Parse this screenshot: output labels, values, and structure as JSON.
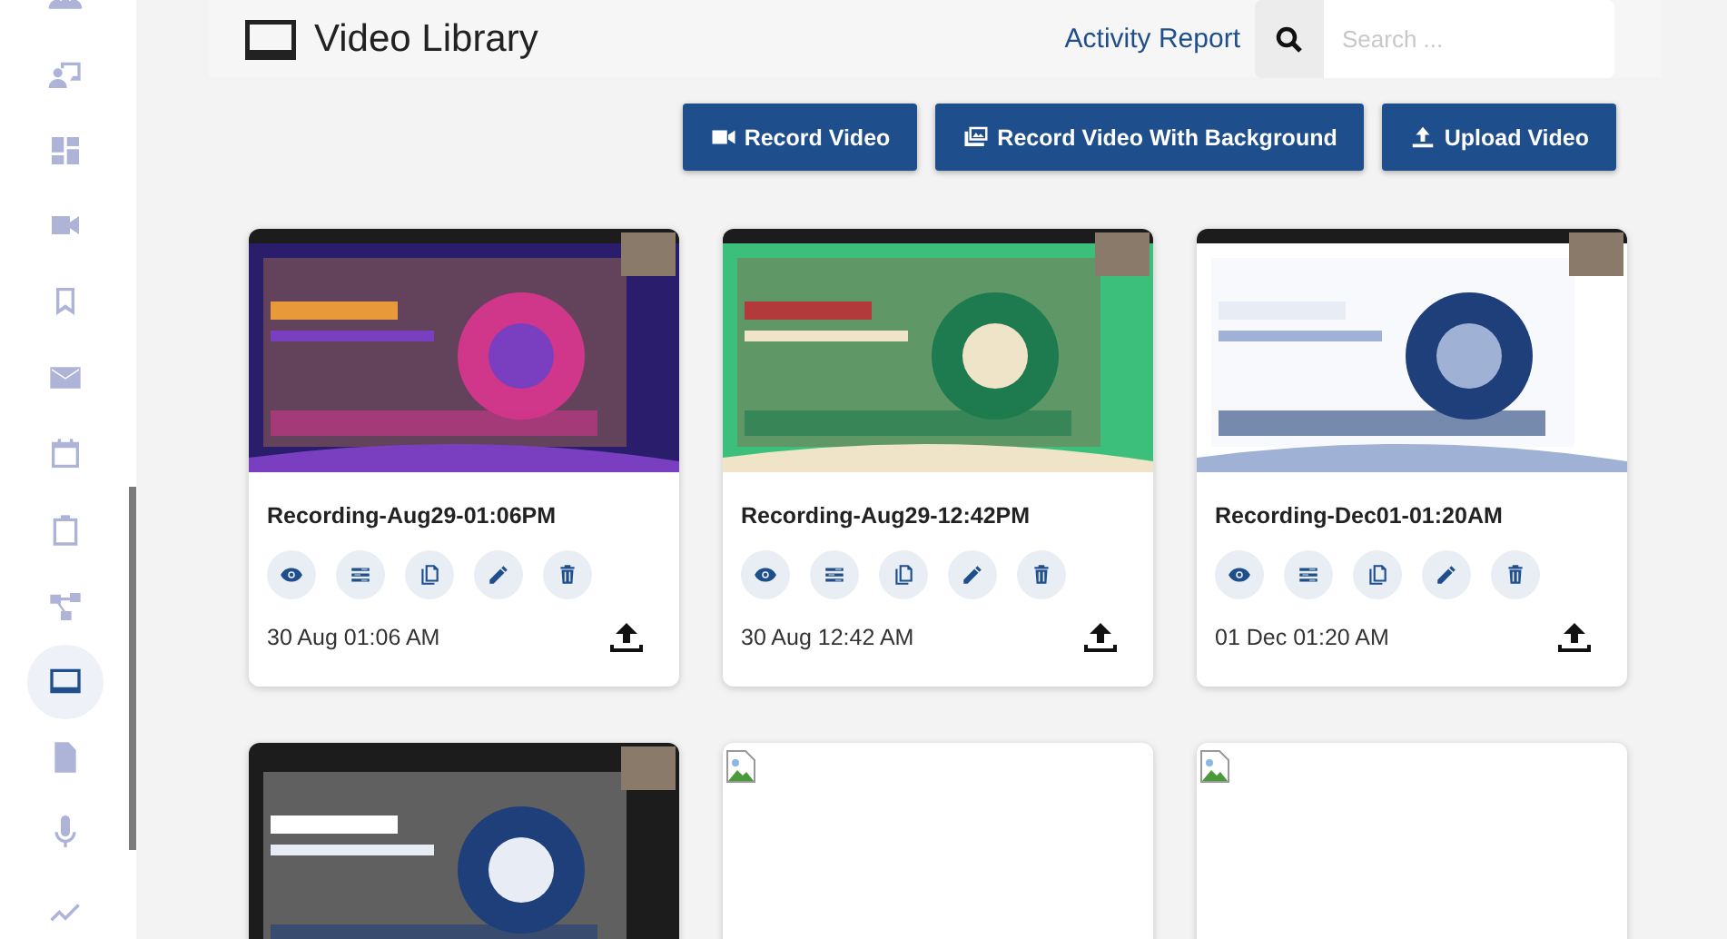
{
  "sidebar": {
    "items": [
      {
        "kind": "people",
        "selected": false
      },
      {
        "kind": "presenter",
        "selected": false
      },
      {
        "kind": "dashboard",
        "selected": false
      },
      {
        "kind": "camera",
        "selected": false
      },
      {
        "kind": "bookmark",
        "selected": false
      },
      {
        "kind": "mail",
        "selected": false
      },
      {
        "kind": "calendar",
        "selected": false
      },
      {
        "kind": "clipboard",
        "selected": false
      },
      {
        "kind": "flow",
        "selected": false
      },
      {
        "kind": "screen",
        "selected": true
      },
      {
        "kind": "file",
        "selected": false
      },
      {
        "kind": "mic",
        "selected": false
      },
      {
        "kind": "trend",
        "selected": false
      }
    ]
  },
  "header": {
    "title": "Video Library",
    "link": "Activity Report",
    "search": {
      "placeholder": "Search ..."
    }
  },
  "buttons": [
    {
      "kind": "camera",
      "label": "Record Video"
    },
    {
      "kind": "images",
      "label": "Record Video With Background"
    },
    {
      "kind": "upload",
      "label": "Upload Video"
    }
  ],
  "videos": [
    {
      "thumbnail": {
        "kind": "picture"
      },
      "title": "Recording-Aug29-01:06PM",
      "date": "30 Aug 01:06 AM"
    },
    {
      "thumbnail": {
        "kind": "picture"
      },
      "title": "Recording-Aug29-12:42PM",
      "date": "30 Aug 12:42 AM"
    },
    {
      "thumbnail": {
        "kind": "picture"
      },
      "title": "Recording-Dec01-01:20AM",
      "date": "01 Dec 01:20 AM"
    },
    {
      "thumbnail": {
        "kind": "picture"
      }
    },
    {
      "thumbnail": {
        "kind": "broken"
      }
    },
    {
      "thumbnail": {
        "kind": "broken"
      }
    }
  ]
}
